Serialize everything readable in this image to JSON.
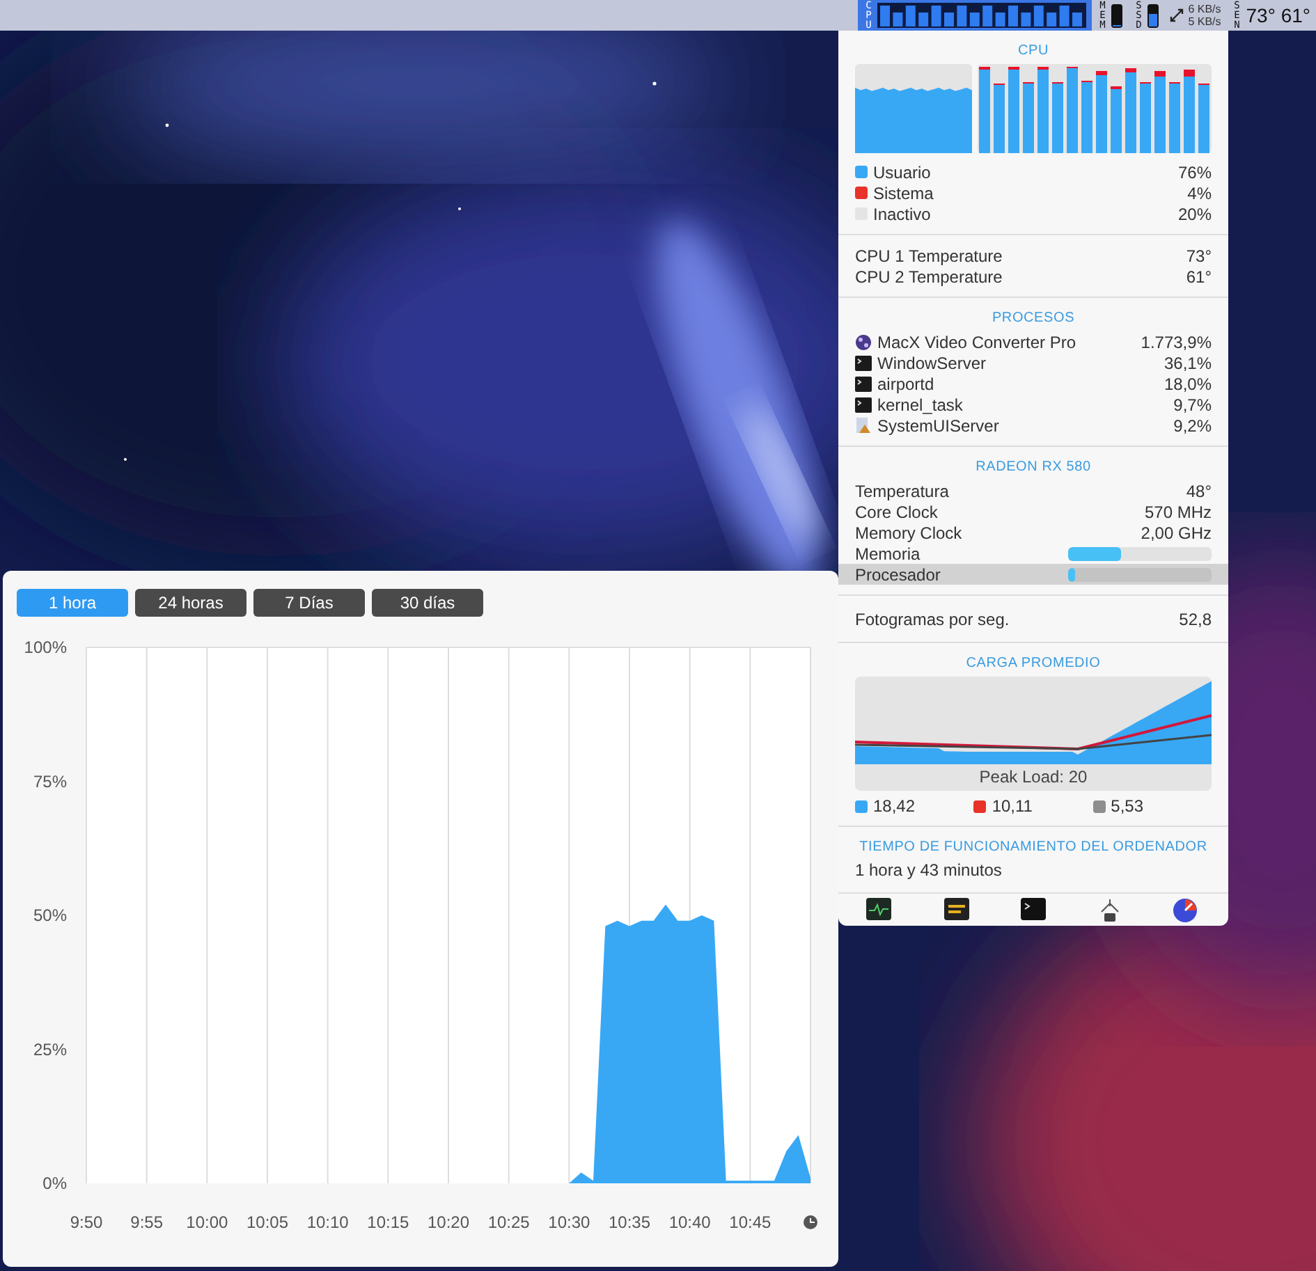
{
  "menu_bar": {
    "items": [
      {
        "kind": "cpu",
        "label": "CPU",
        "selected": true
      },
      {
        "kind": "meter",
        "label": "MEM",
        "level": 0.05
      },
      {
        "kind": "meter",
        "label": "SSD",
        "level": 0.6
      },
      {
        "kind": "net",
        "upload": "6 KB/s",
        "download": "5 KB/s"
      },
      {
        "kind": "sensors",
        "label": "SEN",
        "reading": "73° 61°"
      }
    ]
  },
  "panel": {
    "cpu": {
      "title": "CPU",
      "legend": [
        {
          "label": "Usuario",
          "value": "76%",
          "color": "#38a8f5"
        },
        {
          "label": "Sistema",
          "value": "4%",
          "color": "#e8322a"
        },
        {
          "label": "Inactivo",
          "value": "20%",
          "color": "#e4e4e4"
        }
      ]
    },
    "temperatures": [
      {
        "label": "CPU 1 Temperature",
        "value": "73°"
      },
      {
        "label": "CPU 2 Temperature",
        "value": "61°"
      }
    ],
    "processes": {
      "title": "PROCESOS",
      "items": [
        {
          "kind": "app",
          "name": "MacX Video Converter Pro",
          "value": "1.773,9%"
        },
        {
          "kind": "terminal",
          "name": "WindowServer",
          "value": "36,1%"
        },
        {
          "kind": "terminal",
          "name": "airportd",
          "value": "18,0%"
        },
        {
          "kind": "terminal",
          "name": "kernel_task",
          "value": "9,7%"
        },
        {
          "kind": "system",
          "name": "SystemUIServer",
          "value": "9,2%"
        }
      ]
    },
    "gpu": {
      "title": "RADEON RX 580",
      "rows": [
        {
          "kind": "value",
          "label": "Temperatura",
          "value": "48°",
          "selected": false
        },
        {
          "kind": "value",
          "label": "Core Clock",
          "value": "570 MHz",
          "selected": false
        },
        {
          "kind": "value",
          "label": "Memory Clock",
          "value": "2,00 GHz",
          "selected": false
        },
        {
          "kind": "bar",
          "label": "Memoria",
          "level": 0.37,
          "selected": false
        },
        {
          "kind": "bar",
          "label": "Procesador",
          "level": 0.05,
          "selected": true
        }
      ]
    },
    "fps": {
      "label": "Fotogramas por seg.",
      "value": "52,8"
    },
    "load": {
      "title": "CARGA PROMEDIO",
      "peak": "Peak Load: 20",
      "legend": [
        {
          "value": "18,42",
          "color": "#38a8f5"
        },
        {
          "value": "10,11",
          "color": "#e8322a"
        },
        {
          "value": "5,53",
          "color": "#8e8e8e"
        }
      ]
    },
    "uptime": {
      "title": "TIEMPO DE FUNCIONAMIENTO DEL ORDENADOR",
      "value": "1 hora y 43 minutos"
    }
  },
  "history": {
    "tabs": [
      {
        "label": "1 hora",
        "selected": true
      },
      {
        "label": "24 horas",
        "selected": false
      },
      {
        "label": "7 Días",
        "selected": false
      },
      {
        "label": "30 días",
        "selected": false
      }
    ],
    "chart_data": {
      "type": "area",
      "grid": true,
      "categories": [
        "9:50",
        null,
        null,
        null,
        null,
        "9:55",
        null,
        null,
        null,
        null,
        "10:00",
        null,
        null,
        null,
        null,
        "10:05",
        null,
        null,
        null,
        null,
        "10:10",
        null,
        null,
        null,
        null,
        "10:15",
        null,
        null,
        null,
        null,
        "10:20",
        null,
        null,
        null,
        null,
        "10:25",
        null,
        null,
        null,
        null,
        "10:30",
        null,
        null,
        null,
        null,
        "10:35",
        null,
        null,
        null,
        null,
        "10:40",
        null,
        null,
        null,
        null,
        "10:45",
        null,
        null,
        null,
        null,
        null
      ],
      "series": [
        {
          "color": "#38a8f5",
          "values": [
            0,
            0,
            0,
            0,
            0,
            0,
            0,
            0,
            0,
            0,
            0,
            0,
            0,
            0,
            0,
            0,
            0,
            0,
            0,
            0,
            0,
            0,
            0,
            0,
            0,
            0,
            0,
            0,
            0,
            0,
            0,
            0,
            0,
            0,
            0,
            0,
            0,
            0,
            0,
            0,
            0,
            2,
            0.5,
            48,
            49,
            48,
            49,
            49,
            52,
            49,
            49,
            50,
            49,
            0.5,
            0.5,
            0.5,
            0.5,
            0.5,
            6,
            9,
            1
          ]
        }
      ],
      "ylim": [
        0,
        100
      ],
      "yticks": [
        {
          "value": 0,
          "label": "0%"
        },
        {
          "value": 25,
          "label": "25%"
        },
        {
          "value": 50,
          "label": "50%"
        },
        {
          "value": 75,
          "label": "75%"
        },
        {
          "value": 100,
          "label": "100%"
        }
      ]
    }
  }
}
